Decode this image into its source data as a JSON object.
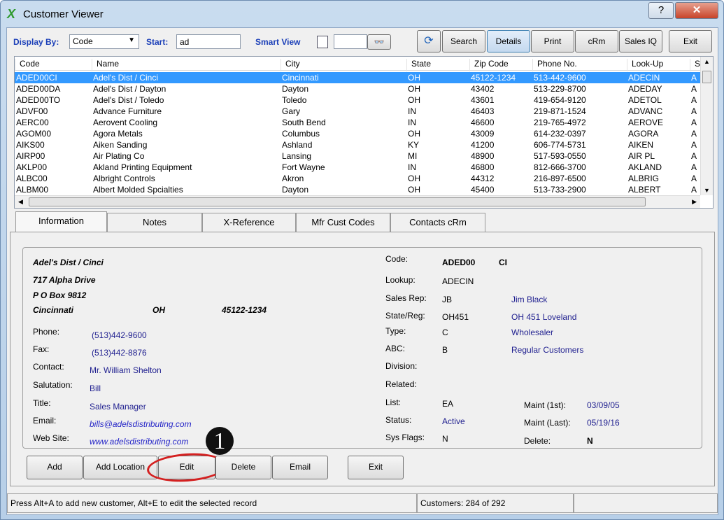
{
  "window": {
    "title": "Customer Viewer",
    "help": "?",
    "close": "✕"
  },
  "toolbar": {
    "display_by_label": "Display By:",
    "display_by_value": "Code",
    "start_label": "Start:",
    "start_value": "ad",
    "smart_view_label": "Smart View",
    "smart_view_value": "",
    "buttons": {
      "refresh": "⟳",
      "search": "Search",
      "details": "Details",
      "print": "Print",
      "crm": "cRm",
      "sales_iq": "Sales IQ",
      "exit": "Exit"
    }
  },
  "grid": {
    "columns": [
      "Code",
      "Name",
      "City",
      "State",
      "Zip Code",
      "Phone No.",
      "Look-Up",
      "S"
    ],
    "rows": [
      [
        "ADED00CI",
        "Adel's Dist / Cinci",
        "Cincinnati",
        "OH",
        "45122-1234",
        "513-442-9600",
        "ADECIN",
        "A"
      ],
      [
        "ADED00DA",
        "Adel's Dist / Dayton",
        "Dayton",
        "OH",
        "43402",
        "513-229-8700",
        "ADEDAY",
        "A"
      ],
      [
        "ADED00TO",
        "Adel's Dist / Toledo",
        "Toledo",
        "OH",
        "43601",
        "419-654-9120",
        "ADETOL",
        "A"
      ],
      [
        "ADVF00",
        "Advance Furniture",
        "Gary",
        "IN",
        "46403",
        "219-871-1524",
        "ADVANC",
        "A"
      ],
      [
        "AERC00",
        "Aerovent Cooling",
        "South Bend",
        "IN",
        "46600",
        "219-765-4972",
        "AEROVE",
        "A"
      ],
      [
        "AGOM00",
        "Agora Metals",
        "Columbus",
        "OH",
        "43009",
        "614-232-0397",
        "AGORA",
        "A"
      ],
      [
        "AIKS00",
        "Aiken Sanding",
        "Ashland",
        "KY",
        "41200",
        "606-774-5731",
        "AIKEN",
        "A"
      ],
      [
        "AIRP00",
        "Air Plating Co",
        "Lansing",
        "MI",
        "48900",
        "517-593-0550",
        "AIR PL",
        "A"
      ],
      [
        "AKLP00",
        "Akland Printing Equipment",
        "Fort Wayne",
        "IN",
        "46800",
        "812-666-3700",
        "AKLAND",
        "A"
      ],
      [
        "ALBC00",
        "Albright Controls",
        "Akron",
        "OH",
        "44312",
        "216-897-6500",
        "ALBRIG",
        "A"
      ],
      [
        "ALBM00",
        "Albert Molded Spcialties",
        "Dayton",
        "OH",
        "45400",
        "513-733-2900",
        "ALBERT",
        "A"
      ]
    ],
    "selected_index": 0
  },
  "tabs": [
    "Information",
    "Notes",
    "X-Reference",
    "Mfr Cust Codes",
    "Contacts cRm"
  ],
  "info": {
    "name": "Adel's Dist / Cinci",
    "address1": "717 Alpha Drive",
    "address2": "P O Box 9812",
    "city": "Cincinnati",
    "state": "OH",
    "zip": "45122-1234",
    "left_fields": [
      {
        "label": "Phone:",
        "value": "(513)442-9600"
      },
      {
        "label": "Fax:",
        "value": "(513)442-8876"
      },
      {
        "label": "Contact:",
        "value": "Mr. William Shelton"
      },
      {
        "label": "Salutation:",
        "value": "Bill"
      },
      {
        "label": "Title:",
        "value": "Sales Manager"
      },
      {
        "label": "Email:",
        "value": "bills@adelsdistributing.com"
      },
      {
        "label": "Web Site:",
        "value": "www.adelsdistributing.com"
      }
    ],
    "code_label": "Code:",
    "code": "ADED00",
    "code_suffix": "CI",
    "right_fields": [
      {
        "label": "Lookup:",
        "value": "ADECIN",
        "desc": ""
      },
      {
        "label": "Sales Rep:",
        "value": "JB",
        "desc": "Jim Black"
      },
      {
        "label": "State/Reg:",
        "value": "OH451",
        "desc": "OH 451 Loveland"
      },
      {
        "label": "Type:",
        "value": "C",
        "desc": "Wholesaler"
      },
      {
        "label": "ABC:",
        "value": "B",
        "desc": "Regular Customers"
      },
      {
        "label": "Division:",
        "value": "",
        "desc": ""
      },
      {
        "label": "Related:",
        "value": "",
        "desc": ""
      },
      {
        "label": "List:",
        "value": "EA",
        "desc": ""
      },
      {
        "label": "Status:",
        "value": "Active",
        "desc": ""
      },
      {
        "label": "Sys Flags:",
        "value": "N",
        "desc": ""
      }
    ],
    "maint_first_label": "Maint (1st):",
    "maint_first": "03/09/05",
    "maint_last_label": "Maint (Last):",
    "maint_last": "05/19/16",
    "delete_label": "Delete:",
    "delete": "N"
  },
  "actions": {
    "add": "Add",
    "add_location": "Add Location",
    "edit": "Edit",
    "delete": "Delete",
    "email": "Email",
    "exit": "Exit"
  },
  "callout": "1",
  "status": {
    "hint": "Press Alt+A to add new customer,  Alt+E to edit the selected record",
    "count": "Customers: 284 of 292"
  }
}
